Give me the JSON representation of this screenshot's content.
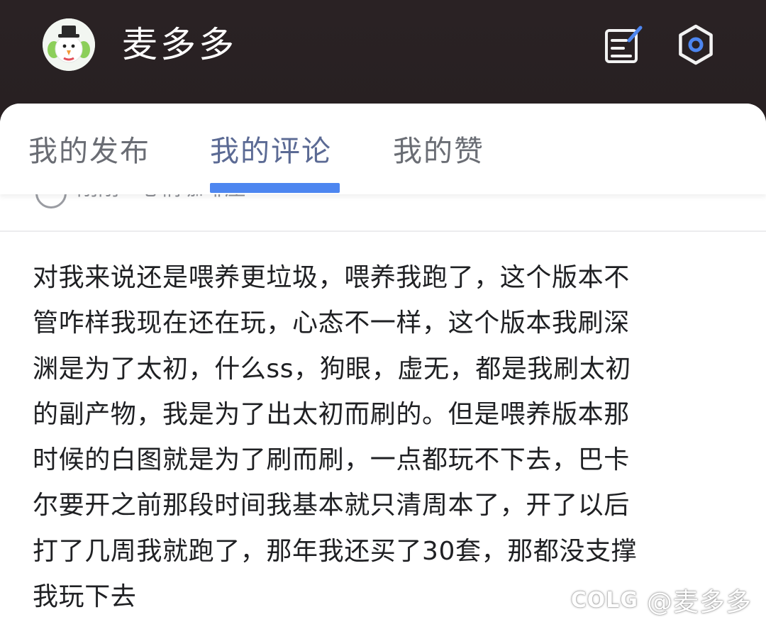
{
  "header": {
    "app_title": "麦多多",
    "avatar_icon": "snowman-avatar-icon",
    "edit_icon": "edit-note-icon",
    "settings_icon": "gear-icon",
    "accent_color": "#4d86f0"
  },
  "tabs": [
    {
      "label": "我的发布",
      "active": false
    },
    {
      "label": "我的评论",
      "active": true
    },
    {
      "label": "我的赞",
      "active": false
    }
  ],
  "previous_item": {
    "text": "刚刚 · 心情咖啡屋"
  },
  "comment": {
    "lines": [
      "对我来说还是喂养更垃圾，喂养我跑了，这个版本不",
      "管咋样我现在还在玩，心态不一样，这个版本我刷深",
      "渊是为了太初，什么ss，狗眼，虚无，都是我刷太初",
      "的副产物，我是为了出太初而刷的。但是喂养版本那",
      "时候的白图就是为了刷而刷，一点都玩不下去，巴卡",
      "尔要开之前那段时间我基本就只清周本了，开了以后",
      "打了几周我就跑了，那年我还买了30套，那都没支撑",
      "我玩下去"
    ]
  },
  "watermark": {
    "logo": "COLG",
    "handle": "@麦多多"
  }
}
